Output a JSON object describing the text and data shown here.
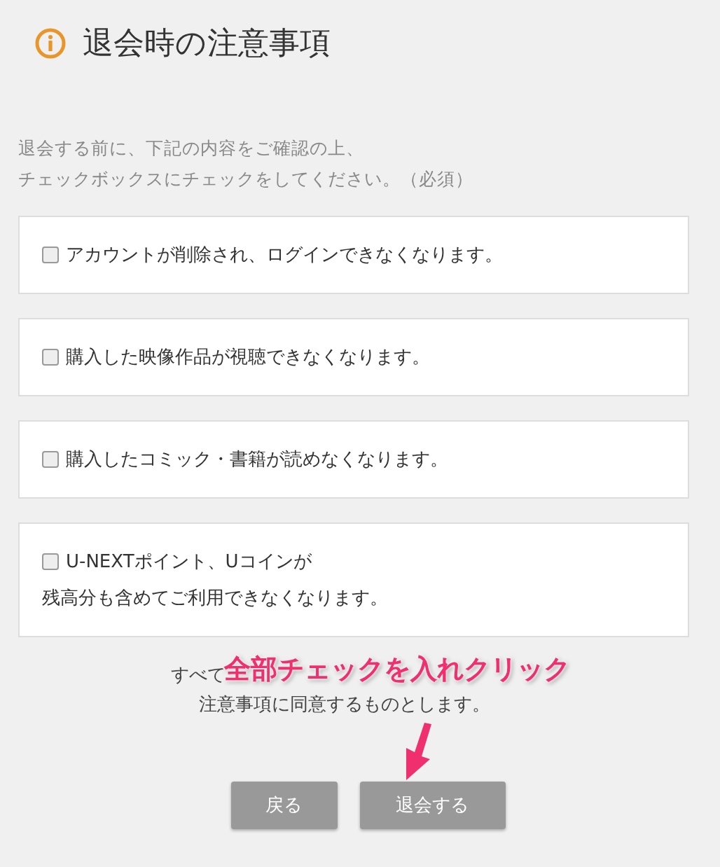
{
  "title": "退会時の注意事項",
  "intro": [
    "退会する前に、下記の内容をご確認の上、",
    "チェックボックスにチェックをしてください。（必須）"
  ],
  "items": [
    {
      "lines": [
        "アカウントが削除され、ログインできなくなります。"
      ],
      "checked": false
    },
    {
      "lines": [
        "購入した映像作品が視聴できなくなります。"
      ],
      "checked": false
    },
    {
      "lines": [
        "購入したコミック・書籍が読めなくなります。"
      ],
      "checked": false
    },
    {
      "lines": [
        "U-NEXTポイント、Uコインが",
        "残高分も含めてご利用できなくなります。"
      ],
      "checked": false
    }
  ],
  "agreement": [
    "すべて",
    "注意事項に同意するものとします。"
  ],
  "annotation": "全部チェックを入れクリック",
  "buttons": [
    "戻る",
    "退会する"
  ]
}
